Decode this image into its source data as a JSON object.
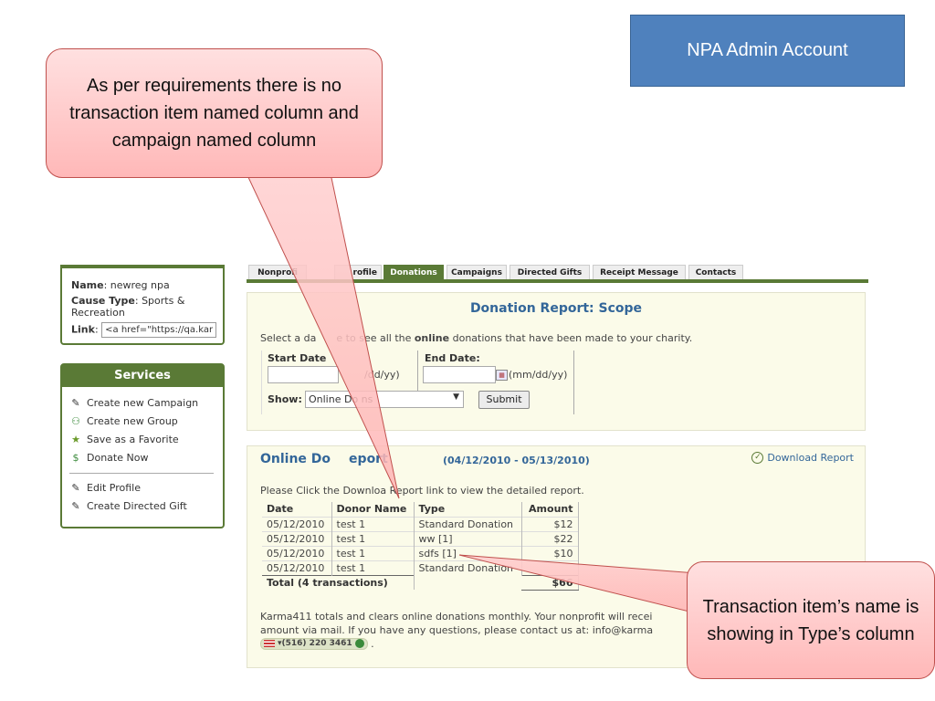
{
  "header_box": {
    "title": "NPA Admin Account"
  },
  "profile": {
    "name_label": "Name",
    "name_value": "newreg npa",
    "cause_label": "Cause Type",
    "cause_value": "Sports & Recreation",
    "link_label": "Link",
    "link_value": "<a href=\"https://qa.kar"
  },
  "services": {
    "title": "Services",
    "items": [
      {
        "label": "Create new Campaign",
        "icon": "edit-icon"
      },
      {
        "label": "Create new Group",
        "icon": "group-add-icon"
      },
      {
        "label": "Save as a Favorite",
        "icon": "star-icon"
      },
      {
        "label": "Donate Now",
        "icon": "donate-icon"
      },
      {
        "label": "Edit Profile",
        "icon": "edit-icon"
      },
      {
        "label": "Create Directed Gift",
        "icon": "edit-icon"
      }
    ]
  },
  "tabs": [
    {
      "label": "Nonprofi"
    },
    {
      "label": "rofile"
    },
    {
      "label": "Donations",
      "active": true
    },
    {
      "label": "Campaigns"
    },
    {
      "label": "Directed Gifts"
    },
    {
      "label": "Receipt Message"
    },
    {
      "label": "Contacts"
    }
  ],
  "scope": {
    "title": "Donation Report: Scope",
    "text_before": "Select a da",
    "text_mid": "e to see all the ",
    "text_bold": "online",
    "text_after": " donations that have been made to your charity.",
    "start_label": "Start Date",
    "end_label": "End Date:",
    "start_format": "/dd/yy)",
    "end_format": "(mm/dd/yy)",
    "start_value": "",
    "end_value": "",
    "show_label": "Show:",
    "show_selected": "Online Do     ns",
    "submit_label": "Submit"
  },
  "report": {
    "title_a": "Online Do",
    "title_b": "eport",
    "range": "(04/12/2010 - 05/13/2010)",
    "download_label": "Download Report",
    "instruction_a": "Please Click the Downloa",
    "instruction_b": " Report link to view the detailed report.",
    "columns": [
      "Date",
      "Donor Name",
      "Type",
      "Amount"
    ],
    "rows": [
      {
        "date": "05/12/2010",
        "donor": "test 1",
        "type": "Standard Donation",
        "amount": "$12"
      },
      {
        "date": "05/12/2010",
        "donor": "test 1",
        "type": "ww [1]",
        "amount": "$22"
      },
      {
        "date": "05/12/2010",
        "donor": "test 1",
        "type": "sdfs [1]",
        "amount": "$10"
      },
      {
        "date": "05/12/2010",
        "donor": "test 1",
        "type": "Standard Donation",
        "amount": ""
      }
    ],
    "total_label": "Total (4 transactions)",
    "total_amount": "$66",
    "footer_line1": "Karma411 totals and clears online donations monthly. Your nonprofit will recei",
    "footer_line2": "amount via mail. If you have any questions, please contact us at: info@karma",
    "phone": "(516) 220 3461",
    "phone_after": " ."
  },
  "callouts": {
    "left": "As per requirements there is no transaction item named column and  campaign named column",
    "right": "Transaction item’s name is showing  in Type’s column"
  }
}
